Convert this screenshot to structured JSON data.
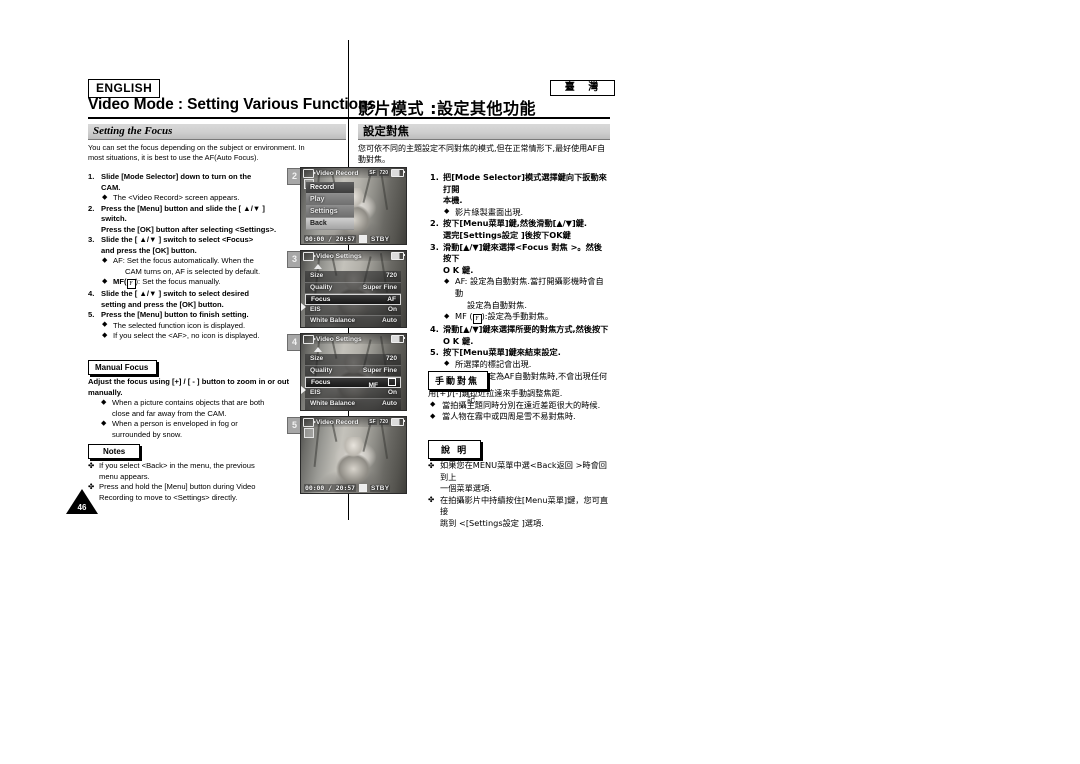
{
  "header": {
    "language_badge": "ENGLISH",
    "region_badge": "臺 灣",
    "title_en": "Video Mode : Setting Various Functions",
    "title_cn": "影片模式 :設定其他功能"
  },
  "section": {
    "title_en": "Setting the Focus",
    "title_cn": "設定對焦",
    "intro_en": "You can set the focus depending on the subject or environment. In most situations, it is best to use the AF(Auto Focus).",
    "intro_cn": "您可依不同的主題設定不同對焦的模式,但在正常情形下,最好使用AF自動對焦。"
  },
  "steps_en": [
    {
      "num": "1.",
      "text": "Slide [Mode Selector] down to turn on the CAM.",
      "subs": [
        "The <Video Record> screen appears."
      ]
    },
    {
      "num": "2.",
      "text": "Press the [Menu] button and slide the [ ▲/▼ ] switch.",
      "cont": "Press the [OK] button after selecting <Settings>.",
      "subs": []
    },
    {
      "num": "3.",
      "text": "Slide the [ ▲/▼ ] switch to select <Focus> and press the [OK] button.",
      "subs": [
        "AF: Set the focus automatically. When the CAM turns on, AF is selected by default."
      ],
      "sub_indent": "CAM turns on, AF is selected by default.",
      "sub_mf_prefix": "MF(",
      "sub_mf_suffix": "): Set the focus manually."
    },
    {
      "num": "4.",
      "text": "Slide the [ ▲/▼ ] switch to select desired setting and press the [OK] button.",
      "subs": []
    },
    {
      "num": "5.",
      "text": "Press the [Menu] button to finish setting.",
      "subs": [
        "The selected function icon is displayed.",
        "If you select the <AF>, no icon is displayed."
      ]
    }
  ],
  "steps_en_flat": {
    "s1_main": "Slide [Mode Selector] down to turn on the",
    "s1_main2": "CAM.",
    "s1_sub1": "The <Video Record> screen appears.",
    "s2_main": "Press the [Menu] button and slide the [ ▲/▼ ]",
    "s2_main2": "switch.",
    "s2_cont": "Press the [OK] button after selecting <Settings>.",
    "s3_main": "Slide the [ ▲/▼ ] switch to select <Focus>",
    "s3_main2": "and press the [OK] button.",
    "s3_sub1": "AF: Set the focus automatically. When the",
    "s3_sub1b": "CAM turns on, AF is selected by default.",
    "s3_sub2_pre": "MF(",
    "s3_sub2_post": "): Set the focus manually.",
    "s4_main": "Slide the [ ▲/▼ ] switch to select desired",
    "s4_main2": "setting and press the [OK] button.",
    "s5_main": "Press the [Menu] button to finish setting.",
    "s5_sub1": "The selected function icon is displayed.",
    "s5_sub2": "If you select the <AF>, no icon is displayed."
  },
  "steps_cn_flat": {
    "s1_main": "把[Mode Selector]模式選擇鍵向下扳動來打開",
    "s1_main2": "本機.",
    "s1_sub1": "影片綠製畫面出現.",
    "s2_main": "按下[Menu菜單]鍵,然後滑動[▲/▼]鍵.",
    "s2_cont": "選完[Settings設定 ]後按下OK鍵",
    "s3_main": "滑動[▲/▼]鍵來選擇<Focus 對焦 >。然後按下",
    "s3_main2": "O K 鍵.",
    "s3_sub1": "AF: 設定為自動對焦.當打開攝影機時會自動",
    "s3_sub1b": "設定為自動對焦.",
    "s3_sub2_pre": "MF (",
    "s3_sub2_post": "):設定為手動對焦。",
    "s4_main": "滑動[▲/▼]鍵來選擇所要的對焦方式,然後按下",
    "s4_main2": "O K 鍵.",
    "s5_main": "按下[Menu菜單]鍵來結束設定.",
    "s5_sub1": "所選擇的標記會出現.",
    "s5_sub2": "如果您設定為AF自動對焦時,不會出現任何標",
    "s5_sub2b": "記."
  },
  "manual_focus": {
    "label_en": "Manual Focus",
    "label_cn": "手動對焦",
    "body_en_1": "Adjust the focus using [+] / [ - ] button to zoom",
    "body_en_2": "in or out manually.",
    "bullets_en": [
      "When a picture contains objects that are both",
      "close and far away from the CAM.",
      "When a person is enveloped in fog or",
      "surrounded by snow."
    ],
    "body_cn_1": "用[+]/[-]鍵拉近拉遠來手動調整焦距.",
    "bullets_cn": [
      "當拍攝主題同時分別在遠近差距很大的時候.",
      "當人物在霧中或四周是雪不易對焦時."
    ]
  },
  "notes": {
    "label_en": "Notes",
    "label_cn": "說 明",
    "items_en": [
      "If you select <Back> in the menu, the previous menu appears.",
      "Press and hold the [Menu] button during Video Recording to move to <Settings> directly."
    ],
    "items_en_lines": {
      "n1a": "If you select <Back> in the menu, the previous",
      "n1b": "menu appears.",
      "n2a": "Press and hold the [Menu] button during Video",
      "n2b": "Recording to move to <Settings> directly."
    },
    "items_cn_lines": {
      "n1a": "如果您在MENU菜單中選<Back返回 >時會回到上",
      "n1b": "一個菜單選項.",
      "n2a": "在拍攝影片中持續按住[Menu菜單]鍵，您可直接",
      "n2b": "跳到 <[Settings設定 ]選項."
    }
  },
  "screens": [
    {
      "step": "2",
      "osd_title": "Video Record",
      "osd_badges": [
        "SF",
        "720"
      ],
      "timecode": "00:00 / 20:57",
      "status": "STBY",
      "menu_items": [
        {
          "label": "Record",
          "state": "normal"
        },
        {
          "label": "Play",
          "state": "dim"
        },
        {
          "label": "Settings",
          "state": "dim"
        },
        {
          "label": "Back",
          "state": "selected"
        }
      ]
    },
    {
      "step": "3",
      "osd_title": "Video Settings",
      "rows": [
        {
          "name": "Size",
          "value": "720"
        },
        {
          "name": "Quality",
          "value": "Super Fine"
        },
        {
          "name": "Focus",
          "value": "AF",
          "highlight": true
        },
        {
          "name": "EIS",
          "value": "On"
        },
        {
          "name": "White Balance",
          "value": "Auto"
        }
      ]
    },
    {
      "step": "4",
      "osd_title": "Video Settings",
      "rows": [
        {
          "name": "Size",
          "value": "720"
        },
        {
          "name": "Quality",
          "value": "Super Fine"
        },
        {
          "name": "Focus",
          "value": "MF",
          "highlight": true
        },
        {
          "name": "EIS",
          "value": "On"
        },
        {
          "name": "White Balance",
          "value": "Auto"
        }
      ]
    },
    {
      "step": "5",
      "osd_title": "Video Record",
      "osd_badges": [
        "SF",
        "720"
      ],
      "timecode": "00:00 / 20:57",
      "status": "STBY"
    }
  ],
  "page_number": "46"
}
